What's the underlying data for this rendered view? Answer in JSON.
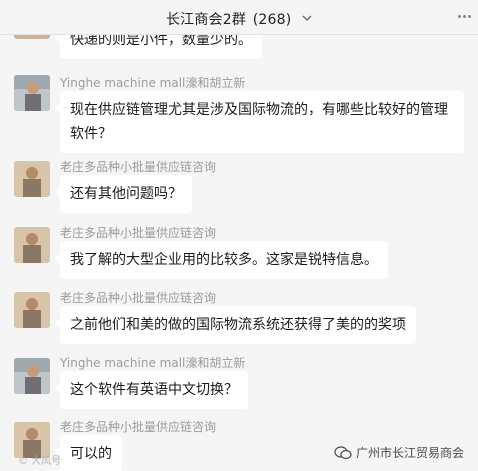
{
  "header": {
    "group_name": "长江商会2群",
    "member_count": "(268)",
    "dropdown_icon": "chevron-down-icon",
    "more_icon": "more-icon"
  },
  "messages": [
    {
      "sender": "",
      "text": "快递的则是小件，数量少的。",
      "partial": true
    },
    {
      "sender": "Yinghe machine mall濠和胡立新",
      "text": "现在供应链管理尤其是涉及国际物流的，有哪些比较好的管理软件？"
    },
    {
      "sender": "老庄多品种小批量供应链咨询",
      "text": "还有其他问题吗？"
    },
    {
      "sender": "老庄多品种小批量供应链咨询",
      "text": "我了解的大型企业用的比较多。这家是锐特信息。"
    },
    {
      "sender": "老庄多品种小批量供应链咨询",
      "text": "之前他们和美的做的国际物流系统还获得了美的的奖项"
    },
    {
      "sender": "Yinghe machine mall濠和胡立新",
      "text": "这个软件有英语中文切换？"
    },
    {
      "sender": "老庄多品种小批量供应链咨询",
      "text": "可以的"
    }
  ],
  "watermark": {
    "text": "广州市长江贸易商会",
    "left_text": "© 大风号"
  },
  "colors": {
    "background": "#f5f5f5",
    "bubble": "#ffffff",
    "sender": "#9b9b9b"
  }
}
